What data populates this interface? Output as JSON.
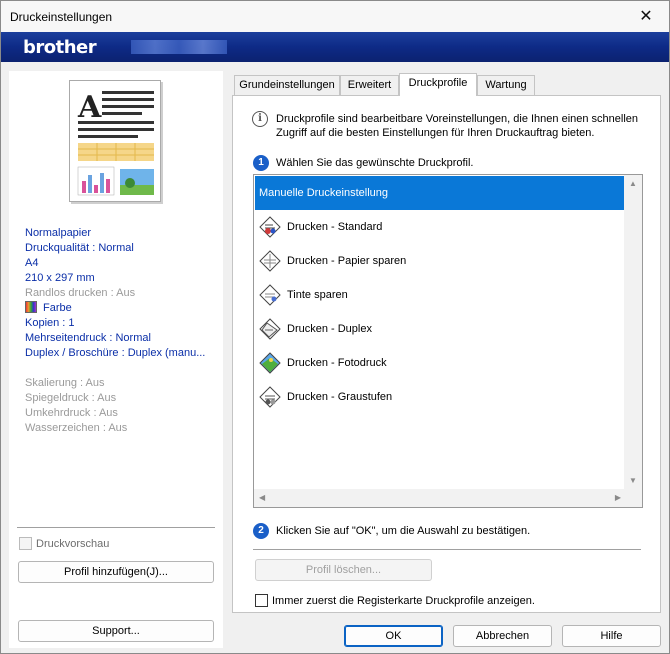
{
  "window": {
    "title": "Druckeinstellungen",
    "close": "✕"
  },
  "brand": {
    "logo": "brother"
  },
  "preview": {
    "big_letter": "A"
  },
  "summary": {
    "media": "Normalpapier",
    "quality": "Druckqualität : Normal",
    "paper_size": "A4",
    "dimensions": "210 x 297 mm",
    "borderless": "Randlos drucken : Aus",
    "color": "Farbe",
    "copies": "Kopien : 1",
    "multipage": "Mehrseitendruck : Normal",
    "duplex": "Duplex / Broschüre : Duplex (manu...",
    "scaling": "Skalierung : Aus",
    "mirror": "Spiegeldruck : Aus",
    "reverse": "Umkehrdruck : Aus",
    "watermark": "Wasserzeichen : Aus"
  },
  "left": {
    "preview_label": "Druckvorschau",
    "add_profile": "Profil hinzufügen(J)...",
    "support": "Support..."
  },
  "tabs": [
    "Grundeinstellungen",
    "Erweitert",
    "Druckprofile",
    "Wartung"
  ],
  "info": "Druckprofile sind bearbeitbare Voreinstellungen, die Ihnen einen schnellen Zugriff auf die besten Einstellungen für Ihren Druckauftrag bieten.",
  "step1": {
    "num": "1",
    "text": "Wählen Sie das gewünschte Druckprofil."
  },
  "profiles": [
    "Manuelle Druckeinstellung",
    "Drucken - Standard",
    "Drucken - Papier sparen",
    "Tinte sparen",
    "Drucken - Duplex",
    "Drucken - Fotodruck",
    "Drucken - Graustufen"
  ],
  "selected_profile_index": 0,
  "step2": {
    "num": "2",
    "text": "Klicken Sie auf \"OK\", um die Auswahl zu bestätigen."
  },
  "delete_profile": "Profil löschen...",
  "always_show": "Immer zuerst die Registerkarte Druckprofile anzeigen.",
  "buttons": {
    "ok": "OK",
    "cancel": "Abbrechen",
    "help": "Hilfe"
  },
  "colors": {
    "brand_blue": "#0e2a86",
    "selection": "#0a78d7",
    "summary_text": "#0b2fa8"
  }
}
